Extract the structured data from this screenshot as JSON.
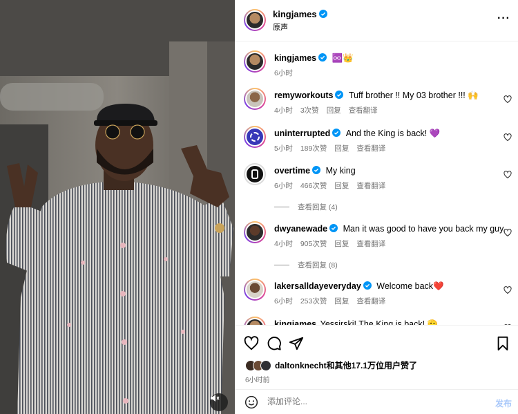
{
  "post": {
    "author": "kingjames",
    "audio": "原声",
    "caption_emojis": "♾️👑",
    "caption_time": "6小时"
  },
  "comments": [
    {
      "user": "remyworkouts",
      "text": "Tuff brother !! My 03 brother !!! 🙌",
      "time": "4小时",
      "likes": "3次赞",
      "reply": "回复",
      "translate": "查看翻译"
    },
    {
      "user": "uninterrupted",
      "text": "And the King is back! 💜",
      "time": "5小时",
      "likes": "189次赞",
      "reply": "回复",
      "translate": "查看翻译"
    },
    {
      "user": "overtime",
      "text": "My king",
      "time": "6小时",
      "likes": "466次赞",
      "reply": "回复",
      "translate": "查看翻译",
      "replies": "查看回复 (4)"
    },
    {
      "user": "dwyanewade",
      "text": "Man it was good to have you back my guy.",
      "time": "4小时",
      "likes": "905次赞",
      "reply": "回复",
      "translate": "查看翻译",
      "replies": "查看回复 (8)"
    },
    {
      "user": "lakersalldayeveryday",
      "text": "Welcome back❤️",
      "time": "6小时",
      "likes": "253次赞",
      "reply": "回复",
      "translate": "查看翻译"
    },
    {
      "user": "kingjames",
      "text": "Yessirski! The King is back! 🫡"
    }
  ],
  "likes_text": "dalton.knecht和其他17.1万位用户赞了",
  "likes_user": "daltonknecht",
  "likes_rest": "和其他17.1万位用户赞了",
  "post_time": "6小时前",
  "add_comment": {
    "placeholder": "添加评论...",
    "post_label": "发布"
  },
  "colors": {
    "verified": "#0095f6",
    "meta": "#737373",
    "post_button": "#a7c7fa"
  },
  "icons": [
    "verified-badge-icon",
    "more-options-icon",
    "heart-icon",
    "comment-icon",
    "share-icon",
    "bookmark-icon",
    "emoji-icon",
    "volume-mute-icon"
  ]
}
